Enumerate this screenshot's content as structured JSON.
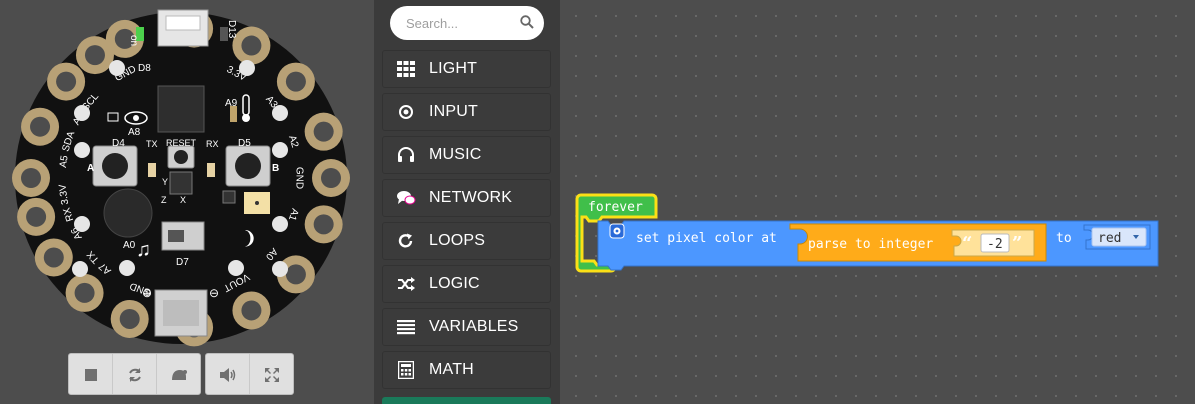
{
  "simulator": {
    "board": {
      "pads": [
        "GND",
        "A1",
        "A2",
        "3.3V",
        "D13",
        "GND",
        "SCL",
        "A4",
        "SDA",
        "A5",
        "3.3V",
        "RX",
        "A6",
        "TX",
        "A7",
        "GND",
        "VOUT",
        "A0",
        "A3",
        "GND"
      ],
      "labels": {
        "on": "on",
        "d13": "D13",
        "d8": "D8",
        "a8": "A8",
        "a9": "A9",
        "d4": "D4",
        "d5": "D5",
        "tx": "TX",
        "rx": "RX",
        "reset": "RESET",
        "btn_a": "A",
        "btn_b": "B",
        "axis_y": "Y",
        "axis_x": "X",
        "axis_z": "Z",
        "a0": "A0",
        "d7": "D7",
        "plus": "⊕",
        "minus": "⊖"
      }
    },
    "toolbar": [
      "stop-icon",
      "restart-icon",
      "slow-motion-icon",
      "mute-icon",
      "fullscreen-icon"
    ]
  },
  "toolbox": {
    "search": {
      "placeholder": "Search..."
    },
    "categories": [
      {
        "label": "LIGHT",
        "icon": "grid-icon",
        "color": "#4c97ff"
      },
      {
        "label": "INPUT",
        "icon": "target-icon",
        "color": "#d65cd6"
      },
      {
        "label": "MUSIC",
        "icon": "headphones-icon",
        "color": "#f2603a"
      },
      {
        "label": "NETWORK",
        "icon": "chat-icon",
        "color": "#e3008c"
      },
      {
        "label": "LOOPS",
        "icon": "refresh-icon",
        "color": "#40bf4a"
      },
      {
        "label": "LOGIC",
        "icon": "shuffle-icon",
        "color": "#45bde6"
      },
      {
        "label": "VARIABLES",
        "icon": "list-icon",
        "color": "#ff5e7b"
      },
      {
        "label": "MATH",
        "icon": "calculator-icon",
        "color": "#9966ff"
      }
    ]
  },
  "workspace": {
    "forever_label": "forever",
    "set_pixel": {
      "label": "set pixel color at",
      "to_label": "to",
      "color_value": "red"
    },
    "parse": {
      "label": "parse to integer",
      "string_value": "-2"
    },
    "colors": {
      "loops": "#40bf4a",
      "loops_dark": "#2e8a35",
      "forever": "#3a9e3f",
      "light": "#4c97ff",
      "math": "#ffab19",
      "string": "#ffe29a",
      "highlight": "#fbe016"
    }
  }
}
